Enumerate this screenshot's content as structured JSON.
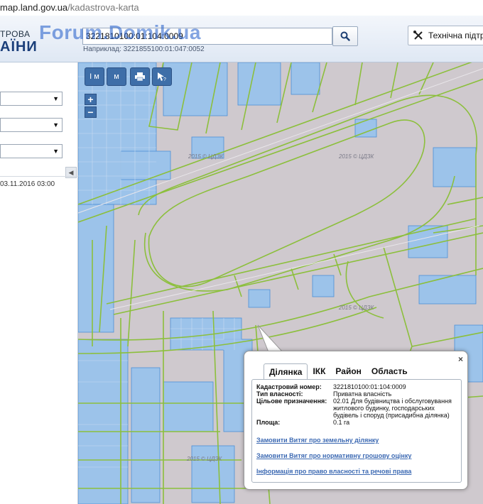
{
  "browser": {
    "url_host": "map.land.gov.ua",
    "url_path": "/kadastrova-karta"
  },
  "header": {
    "logo_line1": "ТРОВА",
    "logo_line2": "АЇНИ",
    "watermark": "Forum.Domik.ua",
    "search_value": "3221810100:01:104:0009",
    "search_hint": "Наприклад: 3221855100:01:047:0052",
    "support_label": "Технічна підтри"
  },
  "sidebar": {
    "date": "03.11.2016 03:00"
  },
  "map": {
    "copyright": "2015 © ЦДЗК"
  },
  "toolbar": {
    "btn1": "I м",
    "btn2": "м",
    "zoom_in": "+",
    "zoom_out": "−"
  },
  "popup": {
    "close": "×",
    "tabs": [
      "Ділянка",
      "ІКК",
      "Район",
      "Область"
    ],
    "fields": [
      {
        "label": "Кадастровий номер:",
        "value": "3221810100:01:104:0009"
      },
      {
        "label": "Тип власності:",
        "value": "Приватна власність"
      },
      {
        "label": "Цільове призначення:",
        "value": "02.01 Для будівництва і обслуговування житлового будинку, господарських будівель і споруд (присадибна ділянка)"
      },
      {
        "label": "Площа:",
        "value": "0.1 га"
      }
    ],
    "links": [
      "Замовити Витяг про земельну ділянку",
      "Замовити Витяг про нормативну грошову оцінку",
      "Інформація про право власності та речові права"
    ]
  },
  "colors": {
    "map_bg": "#cfc9ce",
    "parcel_line": "#8cbf3c",
    "building_fill": "#9cc3ea",
    "building_stroke": "#4b8fd6",
    "accent": "#3e6ea8"
  }
}
